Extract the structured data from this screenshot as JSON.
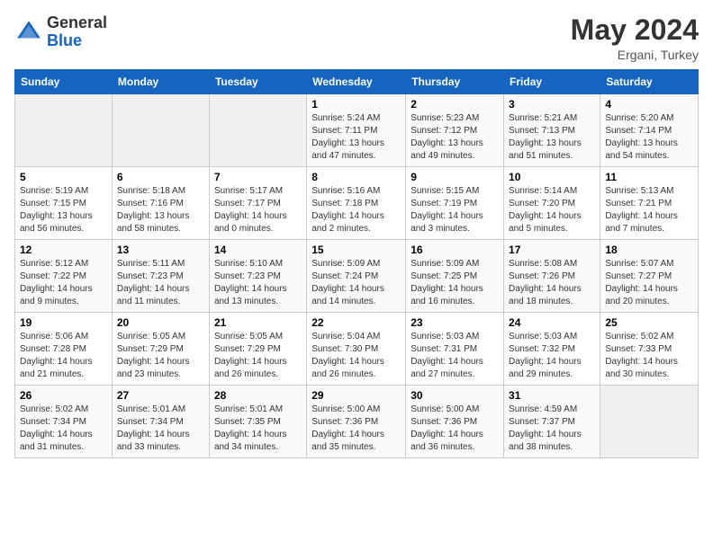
{
  "header": {
    "logo_general": "General",
    "logo_blue": "Blue",
    "month_year": "May 2024",
    "location": "Ergani, Turkey"
  },
  "weekdays": [
    "Sunday",
    "Monday",
    "Tuesday",
    "Wednesday",
    "Thursday",
    "Friday",
    "Saturday"
  ],
  "weeks": [
    [
      {
        "day": "",
        "sunrise": "",
        "sunset": "",
        "daylight": "",
        "empty": true
      },
      {
        "day": "",
        "sunrise": "",
        "sunset": "",
        "daylight": "",
        "empty": true
      },
      {
        "day": "",
        "sunrise": "",
        "sunset": "",
        "daylight": "",
        "empty": true
      },
      {
        "day": "1",
        "sunrise": "Sunrise: 5:24 AM",
        "sunset": "Sunset: 7:11 PM",
        "daylight": "Daylight: 13 hours and 47 minutes.",
        "empty": false
      },
      {
        "day": "2",
        "sunrise": "Sunrise: 5:23 AM",
        "sunset": "Sunset: 7:12 PM",
        "daylight": "Daylight: 13 hours and 49 minutes.",
        "empty": false
      },
      {
        "day": "3",
        "sunrise": "Sunrise: 5:21 AM",
        "sunset": "Sunset: 7:13 PM",
        "daylight": "Daylight: 13 hours and 51 minutes.",
        "empty": false
      },
      {
        "day": "4",
        "sunrise": "Sunrise: 5:20 AM",
        "sunset": "Sunset: 7:14 PM",
        "daylight": "Daylight: 13 hours and 54 minutes.",
        "empty": false
      }
    ],
    [
      {
        "day": "5",
        "sunrise": "Sunrise: 5:19 AM",
        "sunset": "Sunset: 7:15 PM",
        "daylight": "Daylight: 13 hours and 56 minutes.",
        "empty": false
      },
      {
        "day": "6",
        "sunrise": "Sunrise: 5:18 AM",
        "sunset": "Sunset: 7:16 PM",
        "daylight": "Daylight: 13 hours and 58 minutes.",
        "empty": false
      },
      {
        "day": "7",
        "sunrise": "Sunrise: 5:17 AM",
        "sunset": "Sunset: 7:17 PM",
        "daylight": "Daylight: 14 hours and 0 minutes.",
        "empty": false
      },
      {
        "day": "8",
        "sunrise": "Sunrise: 5:16 AM",
        "sunset": "Sunset: 7:18 PM",
        "daylight": "Daylight: 14 hours and 2 minutes.",
        "empty": false
      },
      {
        "day": "9",
        "sunrise": "Sunrise: 5:15 AM",
        "sunset": "Sunset: 7:19 PM",
        "daylight": "Daylight: 14 hours and 3 minutes.",
        "empty": false
      },
      {
        "day": "10",
        "sunrise": "Sunrise: 5:14 AM",
        "sunset": "Sunset: 7:20 PM",
        "daylight": "Daylight: 14 hours and 5 minutes.",
        "empty": false
      },
      {
        "day": "11",
        "sunrise": "Sunrise: 5:13 AM",
        "sunset": "Sunset: 7:21 PM",
        "daylight": "Daylight: 14 hours and 7 minutes.",
        "empty": false
      }
    ],
    [
      {
        "day": "12",
        "sunrise": "Sunrise: 5:12 AM",
        "sunset": "Sunset: 7:22 PM",
        "daylight": "Daylight: 14 hours and 9 minutes.",
        "empty": false
      },
      {
        "day": "13",
        "sunrise": "Sunrise: 5:11 AM",
        "sunset": "Sunset: 7:23 PM",
        "daylight": "Daylight: 14 hours and 11 minutes.",
        "empty": false
      },
      {
        "day": "14",
        "sunrise": "Sunrise: 5:10 AM",
        "sunset": "Sunset: 7:23 PM",
        "daylight": "Daylight: 14 hours and 13 minutes.",
        "empty": false
      },
      {
        "day": "15",
        "sunrise": "Sunrise: 5:09 AM",
        "sunset": "Sunset: 7:24 PM",
        "daylight": "Daylight: 14 hours and 14 minutes.",
        "empty": false
      },
      {
        "day": "16",
        "sunrise": "Sunrise: 5:09 AM",
        "sunset": "Sunset: 7:25 PM",
        "daylight": "Daylight: 14 hours and 16 minutes.",
        "empty": false
      },
      {
        "day": "17",
        "sunrise": "Sunrise: 5:08 AM",
        "sunset": "Sunset: 7:26 PM",
        "daylight": "Daylight: 14 hours and 18 minutes.",
        "empty": false
      },
      {
        "day": "18",
        "sunrise": "Sunrise: 5:07 AM",
        "sunset": "Sunset: 7:27 PM",
        "daylight": "Daylight: 14 hours and 20 minutes.",
        "empty": false
      }
    ],
    [
      {
        "day": "19",
        "sunrise": "Sunrise: 5:06 AM",
        "sunset": "Sunset: 7:28 PM",
        "daylight": "Daylight: 14 hours and 21 minutes.",
        "empty": false
      },
      {
        "day": "20",
        "sunrise": "Sunrise: 5:05 AM",
        "sunset": "Sunset: 7:29 PM",
        "daylight": "Daylight: 14 hours and 23 minutes.",
        "empty": false
      },
      {
        "day": "21",
        "sunrise": "Sunrise: 5:05 AM",
        "sunset": "Sunset: 7:29 PM",
        "daylight": "Daylight: 14 hours and 26 minutes.",
        "empty": false
      },
      {
        "day": "22",
        "sunrise": "Sunrise: 5:04 AM",
        "sunset": "Sunset: 7:30 PM",
        "daylight": "Daylight: 14 hours and 26 minutes.",
        "empty": false
      },
      {
        "day": "23",
        "sunrise": "Sunrise: 5:03 AM",
        "sunset": "Sunset: 7:31 PM",
        "daylight": "Daylight: 14 hours and 27 minutes.",
        "empty": false
      },
      {
        "day": "24",
        "sunrise": "Sunrise: 5:03 AM",
        "sunset": "Sunset: 7:32 PM",
        "daylight": "Daylight: 14 hours and 29 minutes.",
        "empty": false
      },
      {
        "day": "25",
        "sunrise": "Sunrise: 5:02 AM",
        "sunset": "Sunset: 7:33 PM",
        "daylight": "Daylight: 14 hours and 30 minutes.",
        "empty": false
      }
    ],
    [
      {
        "day": "26",
        "sunrise": "Sunrise: 5:02 AM",
        "sunset": "Sunset: 7:34 PM",
        "daylight": "Daylight: 14 hours and 31 minutes.",
        "empty": false
      },
      {
        "day": "27",
        "sunrise": "Sunrise: 5:01 AM",
        "sunset": "Sunset: 7:34 PM",
        "daylight": "Daylight: 14 hours and 33 minutes.",
        "empty": false
      },
      {
        "day": "28",
        "sunrise": "Sunrise: 5:01 AM",
        "sunset": "Sunset: 7:35 PM",
        "daylight": "Daylight: 14 hours and 34 minutes.",
        "empty": false
      },
      {
        "day": "29",
        "sunrise": "Sunrise: 5:00 AM",
        "sunset": "Sunset: 7:36 PM",
        "daylight": "Daylight: 14 hours and 35 minutes.",
        "empty": false
      },
      {
        "day": "30",
        "sunrise": "Sunrise: 5:00 AM",
        "sunset": "Sunset: 7:36 PM",
        "daylight": "Daylight: 14 hours and 36 minutes.",
        "empty": false
      },
      {
        "day": "31",
        "sunrise": "Sunrise: 4:59 AM",
        "sunset": "Sunset: 7:37 PM",
        "daylight": "Daylight: 14 hours and 38 minutes.",
        "empty": false
      },
      {
        "day": "",
        "sunrise": "",
        "sunset": "",
        "daylight": "",
        "empty": true
      }
    ]
  ]
}
